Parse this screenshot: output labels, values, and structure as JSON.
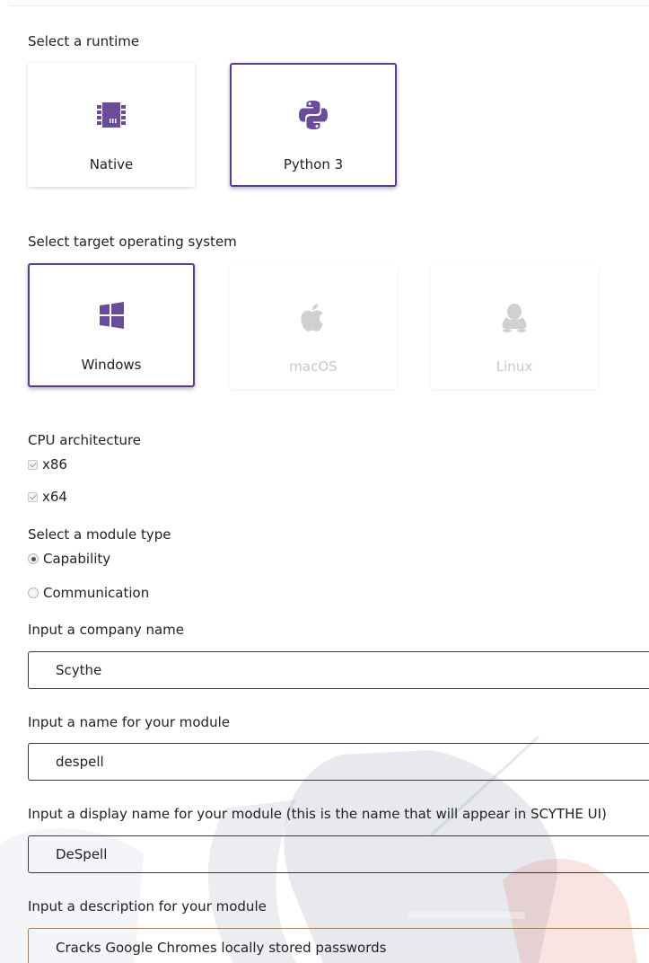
{
  "runtime": {
    "label": "Select a runtime",
    "options": [
      {
        "name": "Native",
        "icon": "chip-icon",
        "selected": false
      },
      {
        "name": "Python 3",
        "icon": "python-icon",
        "selected": true
      }
    ]
  },
  "os": {
    "label": "Select target operating system",
    "options": [
      {
        "name": "Windows",
        "icon": "windows-icon",
        "selected": true,
        "enabled": true
      },
      {
        "name": "macOS",
        "icon": "apple-icon",
        "selected": false,
        "enabled": false
      },
      {
        "name": "Linux",
        "icon": "linux-icon",
        "selected": false,
        "enabled": false
      }
    ]
  },
  "cpu": {
    "label": "CPU architecture",
    "options": [
      {
        "name": "x86",
        "checked": true
      },
      {
        "name": "x64",
        "checked": true
      }
    ]
  },
  "module_type": {
    "label": "Select a module type",
    "options": [
      {
        "name": "Capability",
        "selected": true
      },
      {
        "name": "Communication",
        "selected": false
      }
    ]
  },
  "fields": {
    "company": {
      "label": "Input a company name",
      "value": "Scythe"
    },
    "module_name": {
      "label": "Input a name for your module",
      "value": "despell"
    },
    "display_name": {
      "label": "Input a display name for your module (this is the name that will appear in SCYTHE UI)",
      "value": "DeSpell"
    },
    "description": {
      "label": "Input a description for your module",
      "value": "Cracks Google Chromes locally stored passwords"
    }
  },
  "colors": {
    "accent": "#5a3d8a",
    "icon_purple": "#6b4c9a",
    "disabled": "#cfcfcf",
    "focus_border": "#b0823a"
  }
}
